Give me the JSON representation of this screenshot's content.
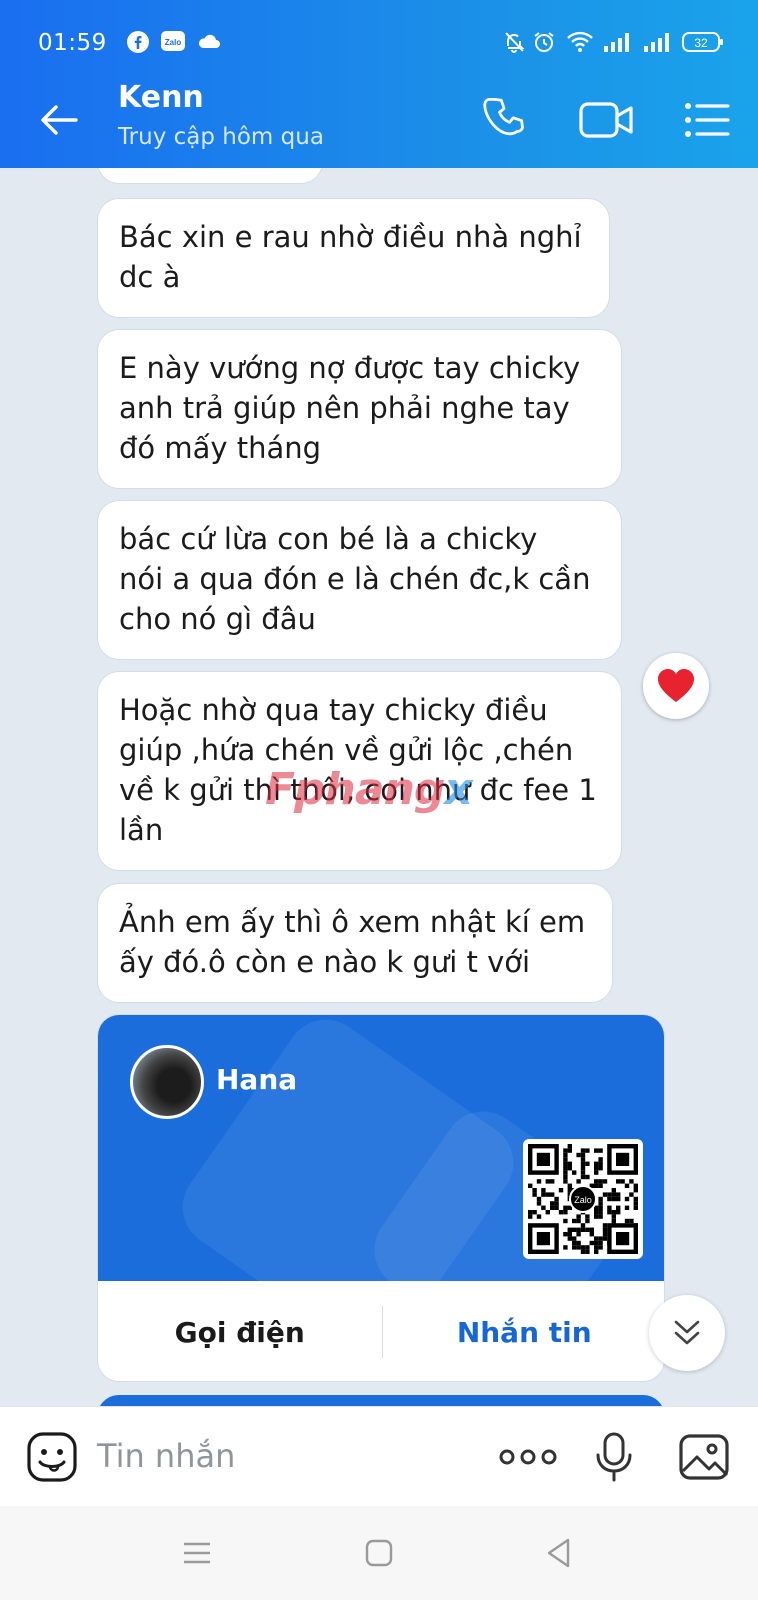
{
  "status_bar": {
    "time": "01:59",
    "battery": "32"
  },
  "header": {
    "contact_name": "Kenn",
    "last_seen": "Truy cập hôm qua"
  },
  "messages": [
    {
      "text": "Bác xin e rau nhờ điều nhà nghỉ\ndc à"
    },
    {
      "text": "E này vướng nợ được tay chicky\nanh trả giúp nên phải nghe tay\nđó mấy tháng"
    },
    {
      "text": "bác cứ lừa con bé là a chicky\nnói a qua đón e là chén đc,k cần\ncho nó gì đâu"
    },
    {
      "text": "Hoặc nhờ qua tay chicky điều\ngiúp ,hứa chén về gửi lộc ,chén\nvề k gửi thì thôi, coi như đc fee 1\nlần"
    },
    {
      "text": "Ảnh em ấy thì ô xem nhật kí em\nấy đó.ô còn e nào k gưi t với"
    }
  ],
  "reaction": {
    "icon": "heart-icon",
    "color": "#e8222e"
  },
  "watermark": {
    "text_main": "Fphang",
    "text_x": "x"
  },
  "contact_card": {
    "name": "Hana",
    "qr_badge": "Zalo",
    "call_label": "Gọi điện",
    "message_label": "Nhắn tin",
    "accent_color": "#1a6ddb"
  },
  "composer": {
    "placeholder": "Tin nhắn"
  },
  "colors": {
    "header_start": "#1a6ef0",
    "header_end": "#1aa3ea",
    "chat_bg": "#e2e9f1"
  }
}
